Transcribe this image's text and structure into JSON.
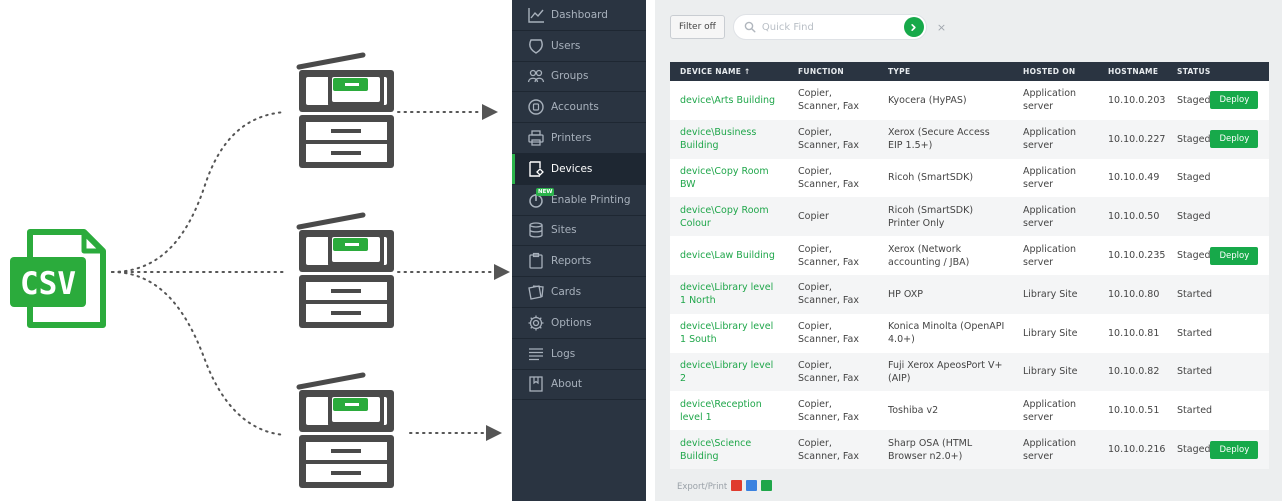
{
  "illustration": {
    "csv_label": "CSV"
  },
  "sidebar": {
    "items": [
      {
        "label": "Dashboard",
        "icon": "chart-line-icon"
      },
      {
        "label": "Users",
        "icon": "shield-icon"
      },
      {
        "label": "Groups",
        "icon": "group-icon"
      },
      {
        "label": "Accounts",
        "icon": "account-icon"
      },
      {
        "label": "Printers",
        "icon": "printer-icon"
      },
      {
        "label": "Devices",
        "icon": "device-icon"
      },
      {
        "label": "Enable Printing",
        "icon": "power-icon",
        "badge": "NEW"
      },
      {
        "label": "Sites",
        "icon": "database-icon"
      },
      {
        "label": "Reports",
        "icon": "clipboard-icon"
      },
      {
        "label": "Cards",
        "icon": "cards-icon"
      },
      {
        "label": "Options",
        "icon": "gear-icon"
      },
      {
        "label": "Logs",
        "icon": "lines-icon"
      },
      {
        "label": "About",
        "icon": "book-icon"
      }
    ],
    "active_index": 5
  },
  "toolbar": {
    "filter_label": "Filter off",
    "search_placeholder": "Quick Find",
    "clear": "×"
  },
  "table": {
    "headers": [
      "DEVICE NAME ↑",
      "FUNCTION",
      "TYPE",
      "HOSTED ON",
      "HOSTNAME",
      "STATUS"
    ],
    "deploy_label": "Deploy",
    "rows": [
      {
        "name": "device\\Arts Building",
        "function": "Copier, Scanner, Fax",
        "type": "Kyocera (HyPAS)",
        "hosted": "Application server",
        "hostname": "10.10.0.203",
        "status": "Staged",
        "deploy": true
      },
      {
        "name": "device\\Business Building",
        "function": "Copier, Scanner, Fax",
        "type": "Xerox (Secure Access EIP 1.5+)",
        "hosted": "Application server",
        "hostname": "10.10.0.227",
        "status": "Staged",
        "deploy": true
      },
      {
        "name": "device\\Copy Room BW",
        "function": "Copier, Scanner, Fax",
        "type": "Ricoh (SmartSDK)",
        "hosted": "Application server",
        "hostname": "10.10.0.49",
        "status": "Staged",
        "deploy": false
      },
      {
        "name": "device\\Copy Room Colour",
        "function": "Copier",
        "type": "Ricoh (SmartSDK) Printer Only",
        "hosted": "Application server",
        "hostname": "10.10.0.50",
        "status": "Staged",
        "deploy": false
      },
      {
        "name": "device\\Law Building",
        "function": "Copier, Scanner, Fax",
        "type": "Xerox (Network accounting / JBA)",
        "hosted": "Application server",
        "hostname": "10.10.0.235",
        "status": "Staged",
        "deploy": true
      },
      {
        "name": "device\\Library level 1 North",
        "function": "Copier, Scanner, Fax",
        "type": "HP OXP",
        "hosted": "Library Site",
        "hostname": "10.10.0.80",
        "status": "Started",
        "deploy": false
      },
      {
        "name": "device\\Library level 1 South",
        "function": "Copier, Scanner, Fax",
        "type": "Konica Minolta (OpenAPI 4.0+)",
        "hosted": "Library Site",
        "hostname": "10.10.0.81",
        "status": "Started",
        "deploy": false
      },
      {
        "name": "device\\Library level 2",
        "function": "Copier, Scanner, Fax",
        "type": "Fuji Xerox ApeosPort V+ (AIP)",
        "hosted": "Library Site",
        "hostname": "10.10.0.82",
        "status": "Started",
        "deploy": false
      },
      {
        "name": "device\\Reception level 1",
        "function": "Copier, Scanner, Fax",
        "type": "Toshiba v2",
        "hosted": "Application server",
        "hostname": "10.10.0.51",
        "status": "Started",
        "deploy": false
      },
      {
        "name": "device\\Science Building",
        "function": "Copier, Scanner, Fax",
        "type": "Sharp OSA (HTML Browser n2.0+)",
        "hosted": "Application server",
        "hostname": "10.10.0.216",
        "status": "Staged",
        "deploy": true
      }
    ]
  },
  "export": {
    "label": "Export/Print",
    "formats": [
      {
        "name": "pdf-icon",
        "color": "#e03b2e"
      },
      {
        "name": "doc-icon",
        "color": "#3b82e0"
      },
      {
        "name": "spreadsheet-icon",
        "color": "#1fa64a"
      }
    ]
  },
  "colors": {
    "accent": "#1fa64a",
    "sidebar": "#2a3441",
    "icon_gray": "#4a4a4a"
  }
}
